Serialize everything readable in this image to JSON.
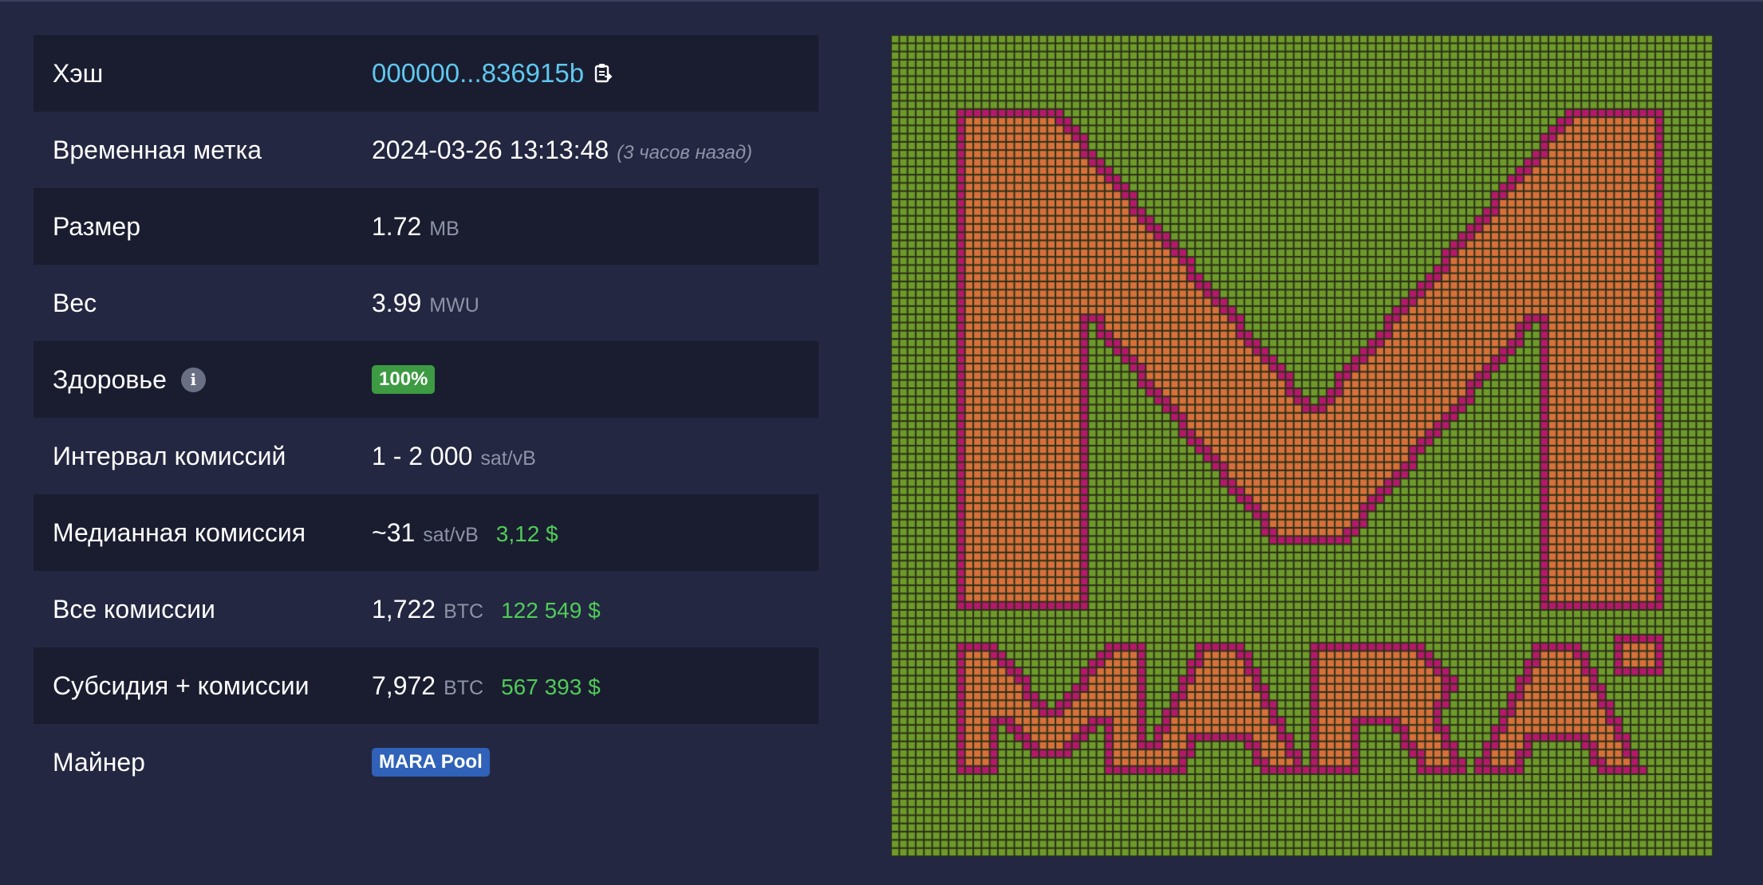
{
  "details": {
    "hash": {
      "label": "Хэш",
      "value": "000000...836915b"
    },
    "timestamp": {
      "label": "Временная метка",
      "value": "2024-03-26 13:13:48",
      "relative": "(3 часов назад)"
    },
    "size": {
      "label": "Размер",
      "value": "1.72",
      "unit": "MB"
    },
    "weight": {
      "label": "Вес",
      "value": "3.99",
      "unit": "MWU"
    },
    "health": {
      "label": "Здоровье",
      "value": "100%"
    },
    "fee_span": {
      "label": "Интервал комиссий",
      "value": "1 - 2 000",
      "unit": "sat/vB"
    },
    "median_fee": {
      "label": "Медианная комиссия",
      "value": "~31",
      "unit": "sat/vB",
      "fiat": "3,12 $"
    },
    "total_fees": {
      "label": "Все комиссии",
      "value": "1,722",
      "unit": "BTC",
      "fiat": "122 549 $"
    },
    "subsidy_fees": {
      "label": "Субсидия + комиссии",
      "value": "7,972",
      "unit": "BTC",
      "fiat": "567 393 $"
    },
    "miner": {
      "label": "Майнер",
      "value": "MARA Pool"
    }
  },
  "icons": {
    "copy": "copy-icon",
    "info": "info-icon"
  },
  "colors": {
    "background": "#232741",
    "row_dark": "#1a1d30",
    "hash_link": "#5fc8ee",
    "fiat": "#4fcc57",
    "health_badge": "#3d9b43",
    "miner_badge": "#2f62b8",
    "mosaic_green": "#6e9a2a",
    "mosaic_orange": "#d8703a",
    "mosaic_magenta": "#b5186a",
    "mosaic_grid": "#2a3019"
  }
}
